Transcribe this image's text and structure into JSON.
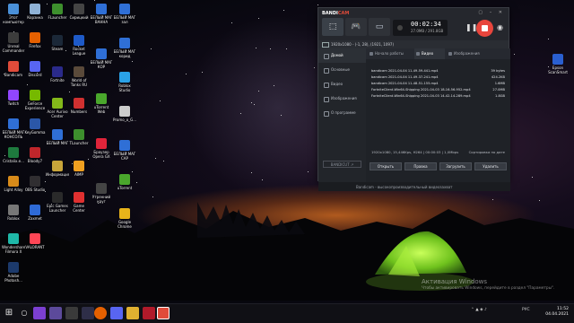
{
  "desktop": {
    "icons_col1": [
      {
        "label": "Этот компьютер",
        "icon": "computer-icon",
        "color": "#4a90d9"
      },
      {
        "label": "Unreal Commander",
        "icon": "unreal-commander-icon",
        "color": "#3c3c3c"
      },
      {
        "label": "Bandicam",
        "icon": "bandicam-icon",
        "color": "#e04b3a"
      },
      {
        "label": "Twitch",
        "icon": "twitch-icon",
        "color": "#9146ff"
      },
      {
        "label": "БЕЛЫЙ МАГ КОНСОЛЬ",
        "icon": "app-icon",
        "color": "#2f6fd6"
      },
      {
        "label": "Cristalix.e...",
        "icon": "cristalix-icon",
        "color": "#1e7a3e"
      },
      {
        "label": "Light Alloy",
        "icon": "light-alloy-icon",
        "color": "#d88b1a"
      },
      {
        "label": "Roblox",
        "icon": "roblox-icon",
        "color": "#777777"
      },
      {
        "label": "Wondershare Filmora X",
        "icon": "filmora-icon",
        "color": "#1fb8a8"
      },
      {
        "label": "Adobe Photosh...",
        "icon": "photoshop-icon",
        "color": "#1c3a6b"
      }
    ],
    "icons_col2": [
      {
        "label": "Корзина",
        "icon": "recycle-bin-icon",
        "color": "#8fb2d6"
      },
      {
        "label": "Firefox",
        "icon": "firefox-icon",
        "color": "#e66000"
      },
      {
        "label": "Discord",
        "icon": "discord-icon",
        "color": "#5865f2"
      },
      {
        "label": "GeForce Experience",
        "icon": "geforce-icon",
        "color": "#76b900"
      },
      {
        "label": "KeyGomma",
        "icon": "keygomma-icon",
        "color": "#2b57a8"
      },
      {
        "label": "Bloody7",
        "icon": "bloody-icon",
        "color": "#c0262b"
      },
      {
        "label": "OBS Studio",
        "icon": "obs-icon",
        "color": "#302e31"
      },
      {
        "label": "Zaxmet",
        "icon": "zaxmet-icon",
        "color": "#2e6ad6"
      },
      {
        "label": "VALORANT",
        "icon": "valorant-icon",
        "color": "#ff4655"
      }
    ],
    "icons_col3": [
      {
        "label": "FLauncher",
        "icon": "flauncher-icon",
        "color": "#3d8f2d"
      },
      {
        "label": "Steam",
        "icon": "steam-icon",
        "color": "#1b2838"
      },
      {
        "label": "Fortnite",
        "icon": "fortnite-icon",
        "color": "#2a2a8a"
      },
      {
        "label": "Acer Aurivo Center",
        "icon": "acer-icon",
        "color": "#83b81a"
      },
      {
        "label": "БЕЛЫЙ МАГ",
        "icon": "app-icon",
        "color": "#2f6fd6"
      },
      {
        "label": "Информация",
        "icon": "info-icon",
        "color": "#c8a53a"
      },
      {
        "label": "Epic Games Launcher",
        "icon": "epic-icon",
        "color": "#2a2a2a"
      }
    ],
    "icons_col4": [
      {
        "label": "Сирицкий",
        "icon": "app-icon",
        "color": "#444444"
      },
      {
        "label": "Rocket League",
        "icon": "rocket-league-icon",
        "color": "#1e5ac8"
      },
      {
        "label": "World of Tanks RU",
        "icon": "wot-icon",
        "color": "#5a4a3a"
      },
      {
        "label": "Numbers",
        "icon": "numbers-icon",
        "color": "#d03030"
      },
      {
        "label": "TLauncher",
        "icon": "tlauncher-icon",
        "color": "#3d8f2d"
      },
      {
        "label": "AIMP",
        "icon": "aimp-icon",
        "color": "#f0a020"
      },
      {
        "label": "Game Center",
        "icon": "game-center-icon",
        "color": "#e03030"
      }
    ],
    "icons_col5": [
      {
        "label": "БЕЛЫЙ МАГ ВАННА",
        "icon": "app-icon",
        "color": "#2f6fd6"
      },
      {
        "label": "БЕЛЫЙ МАГ КОР",
        "icon": "app-icon",
        "color": "#2f6fd6"
      },
      {
        "label": "uTorrent Web",
        "icon": "utorrent-icon",
        "color": "#4aa72c"
      },
      {
        "label": "Браузер Opera GX",
        "icon": "opera-icon",
        "color": "#e0243a"
      },
      {
        "label": "Утренний круг",
        "icon": "app-icon",
        "color": "#444444"
      }
    ],
    "icons_col6": [
      {
        "label": "БЕЛЫЙ МАГ зал",
        "icon": "app-icon",
        "color": "#2f6fd6"
      },
      {
        "label": "БЕЛЫЙ МАГ корид",
        "icon": "app-icon",
        "color": "#2f6fd6"
      },
      {
        "label": "Roblox Studio",
        "icon": "roblox-studio-icon",
        "color": "#2aa2e8"
      },
      {
        "label": "Promo_o_G...",
        "icon": "file-icon",
        "color": "#cccccc"
      },
      {
        "label": "БЕЛЫЙ МАГ САР",
        "icon": "app-icon",
        "color": "#2f6fd6"
      },
      {
        "label": "uTorrent",
        "icon": "utorrent-icon",
        "color": "#4aa72c"
      },
      {
        "label": "Google Chrome",
        "icon": "chrome-icon",
        "color": "#e8b31a"
      }
    ],
    "right_icons": [
      {
        "label": "Epson ScanSmart",
        "icon": "epson-icon",
        "color": "#2a5fd0"
      }
    ]
  },
  "bandicam": {
    "logo_a": "BANDI",
    "logo_b": "CAM",
    "timer": "00:02:34",
    "size": "27.0MB / 291.8GB",
    "info": "1920x1080 - (-1, 28), (1921, 1097)",
    "sidebar": [
      {
        "label": "Домой",
        "active": true
      },
      {
        "label": "Основные",
        "active": false
      },
      {
        "label": "Видео",
        "active": false
      },
      {
        "label": "Изображения",
        "active": false
      },
      {
        "label": "О программе",
        "active": false
      }
    ],
    "brand": "BANDICUT ↗",
    "tabs": [
      "Начало работы",
      "Видео",
      "Изображения"
    ],
    "files": [
      {
        "name": "bandicam 2021-04-04 11-49-59-441.mp4",
        "size": "39 bytes"
      },
      {
        "name": "bandicam 2021-04-04 11-49-37-241.mp4",
        "size": "424.2KB"
      },
      {
        "name": "bandicam 2021-04-04 11-48-51-155.mp4",
        "size": "1.6MB"
      },
      {
        "name": "FortniteClient-Win64-Shipping 2021-04-03 18-16-56-952.mp4",
        "size": "27.0MB"
      },
      {
        "name": "FortniteClient-Win64-Shipping 2021-04-03 14-42-14-289.mp4",
        "size": "1.8GB"
      }
    ],
    "status_left": "1920x1080, 15,446Kps, H264 | 00:00:03 | 1,0Mbps",
    "status_right": "Сортировка по дате",
    "buttons": [
      "Открыть",
      "Правка",
      "Загрузить",
      "Удалить"
    ],
    "footer": "Bandicam - высокопроизводительный видеозахват"
  },
  "activate": {
    "title": "Активация Windows",
    "subtitle": "Чтобы активировать Windows, перейдите в раздел \"Параметры\"."
  },
  "taskbar": {
    "lang": "РУС",
    "time": "11:52",
    "date": "04.04.2021"
  }
}
